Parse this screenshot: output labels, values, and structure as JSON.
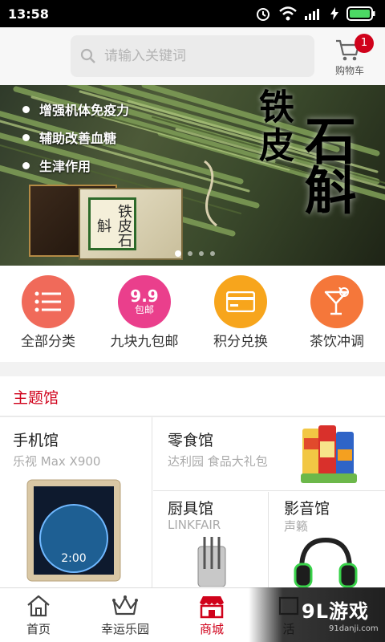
{
  "status_bar": {
    "time": "13:58"
  },
  "header": {
    "search_placeholder": "请输入关键词",
    "cart_label": "购物车",
    "cart_badge": "1"
  },
  "banner": {
    "bullets": [
      "增强机体免疫力",
      "辅助改善血糖",
      "生津作用"
    ],
    "brand_line1": "铁皮",
    "brand_line2": "石斛",
    "box_text": "铁皮石斛",
    "page_count": 4,
    "active_page": 1
  },
  "categories": [
    {
      "label": "全部分类",
      "icon": "list-icon",
      "color": "#f06a5a",
      "badge_top": "",
      "badge_bottom": ""
    },
    {
      "label": "九块九包邮",
      "icon": "nine-nine-badge-icon",
      "color": "#ea3f8c",
      "badge_top": "9.9",
      "badge_bottom": "包邮"
    },
    {
      "label": "积分兑换",
      "icon": "card-icon",
      "color": "#f7a51c",
      "badge_top": "",
      "badge_bottom": ""
    },
    {
      "label": "茶饮冲调",
      "icon": "cocktail-icon",
      "color": "#f5773a",
      "badge_top": "",
      "badge_bottom": ""
    }
  ],
  "theme": {
    "title": "主题馆",
    "tiles": [
      {
        "title": "手机馆",
        "subtitle": "乐视 Max X900"
      },
      {
        "title": "零食馆",
        "subtitle": "达利园 食品大礼包"
      },
      {
        "title": "厨具馆",
        "subtitle": "LINKFAIR"
      },
      {
        "title": "影音馆",
        "subtitle": "声籁"
      }
    ]
  },
  "bottom_nav": [
    {
      "label": "首页",
      "icon": "home-icon",
      "active": false
    },
    {
      "label": "幸运乐园",
      "icon": "crown-icon",
      "active": false
    },
    {
      "label": "商城",
      "icon": "shop-icon",
      "active": true
    },
    {
      "label": "活",
      "icon": "activity-icon",
      "active": false
    }
  ],
  "watermark": {
    "logo": "9L游戏",
    "url": "91danji.com"
  },
  "colors": {
    "accent": "#d0021b",
    "badge": "#d0021b"
  }
}
